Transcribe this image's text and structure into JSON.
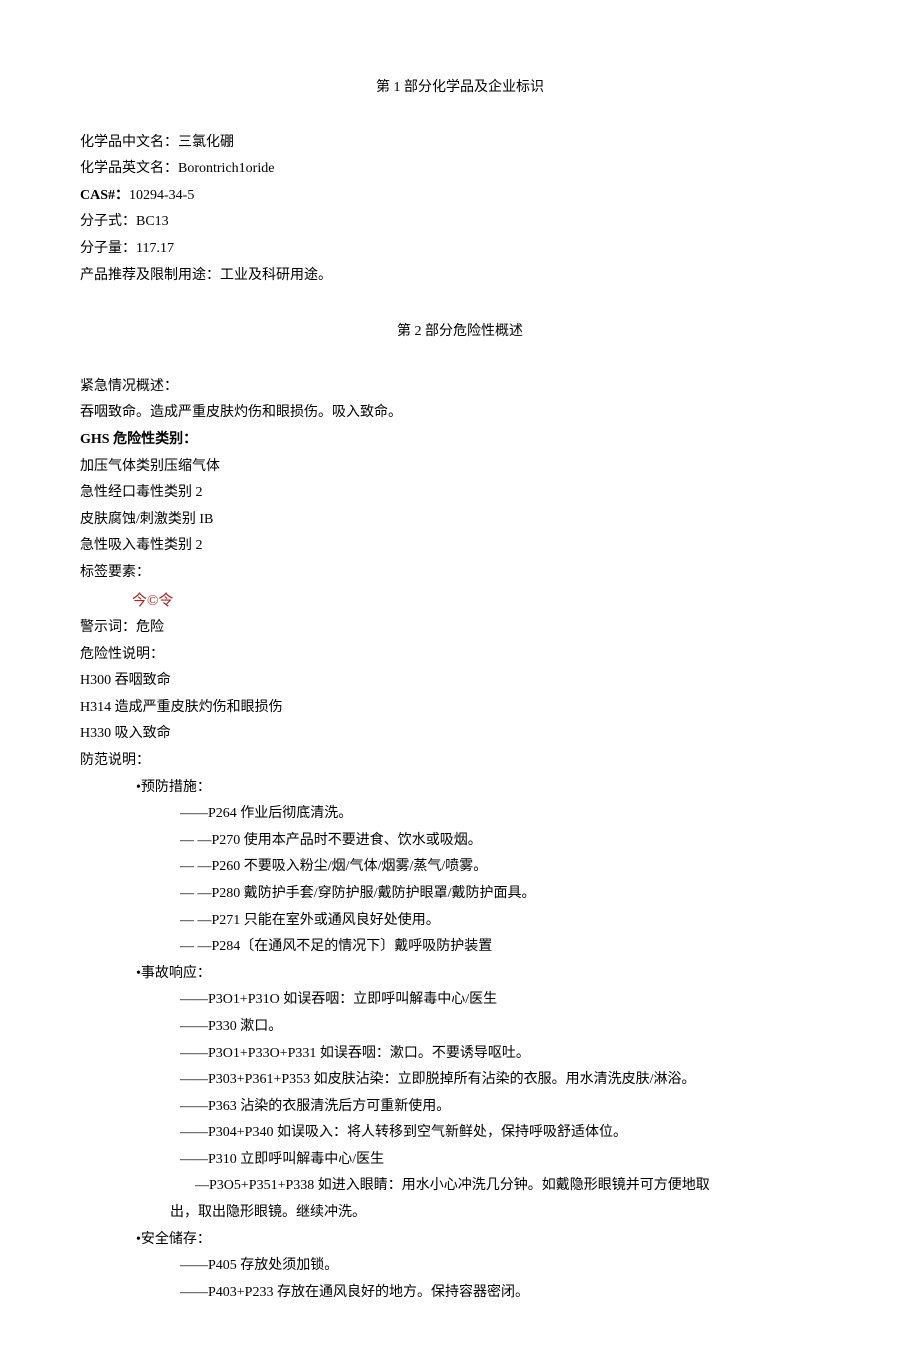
{
  "section1": {
    "title": "第 1 部分化学品及企业标识",
    "name_cn_label": "化学品中文名：",
    "name_cn": "三氯化硼",
    "name_en_label": "化学品英文名：",
    "name_en": "Borontrich1oride",
    "cas_label": "CAS#：",
    "cas": "10294-34-5",
    "formula_label": "分子式：",
    "formula": "BC13",
    "mw_label": "分子量：",
    "mw": "117.17",
    "use_label": "产品推荐及限制用途：",
    "use": "工业及科研用途。"
  },
  "section2": {
    "title": "第 2 部分危险性概述",
    "emergency_label": "紧急情况概述：",
    "emergency": "吞咽致命。造成严重皮肤灼伤和眼损伤。吸入致命。",
    "ghs_label": "GHS 危险性类别：",
    "ghs_items": [
      "加压气体类别压缩气体",
      "急性经口毒性类别 2",
      "皮肤腐蚀/刺激类别 IB",
      "急性吸入毒性类别 2"
    ],
    "label_elem": "标签要素：",
    "pictos": "今©令",
    "signal_label": "警示词：",
    "signal": "危险",
    "hazard_label": "危险性说明：",
    "hazards": [
      "H300 吞咽致命",
      "H314 造成严重皮肤灼伤和眼损伤",
      "H330 吸入致命"
    ],
    "precaution_label": "防范说明：",
    "prevention_head": "•预防措施：",
    "prevention": {
      "p264": "——P264 作业后彻底清洗。",
      "p270": "—        —P270 使用本产品时不要进食、饮水或吸烟。",
      "p260": "—        —P260 不要吸入粉尘/烟/气体/烟雾/蒸气/喷雾。",
      "p280": "—        —P280 戴防护手套/穿防护服/戴防护眼罩/戴防护面具。",
      "p271": "—        —P271 只能在室外或通风良好处使用。",
      "p284": "—        —P284〔在通风不足的情况下〕戴呼吸防护装置"
    },
    "response_head": "•事故响应：",
    "response": {
      "p301_310": "——P3O1+P31O 如误吞咽：立即呼叫解毒中心/医生",
      "p330": "——P330 漱口。",
      "p301_330_331": "——P3O1+P33O+P331 如误吞咽：漱口。不要诱导呕吐。",
      "p303_361_353": "——P303+P361+P353 如皮肤沾染：立即脱掉所有沾染的衣服。用水清洗皮肤/淋浴。",
      "p363": "——P363 沾染的衣服清洗后方可重新使用。",
      "p304_340": "——P304+P340 如误吸入：将人转移到空气新鲜处，保持呼吸舒适体位。",
      "p310": "——P310 立即呼叫解毒中心/医生",
      "p305_351_338": "—P3O5+P351+P338 如进入眼睛：用水小心冲洗几分钟。如戴隐形眼镜并可方便地取",
      "p305_cont": "出，取出隐形眼镜。继续冲洗。"
    },
    "storage_head": "•安全储存：",
    "storage": {
      "p405": "——P405 存放处须加锁。",
      "p403_233": "——P403+P233 存放在通风良好的地方。保持容器密闭。"
    }
  }
}
